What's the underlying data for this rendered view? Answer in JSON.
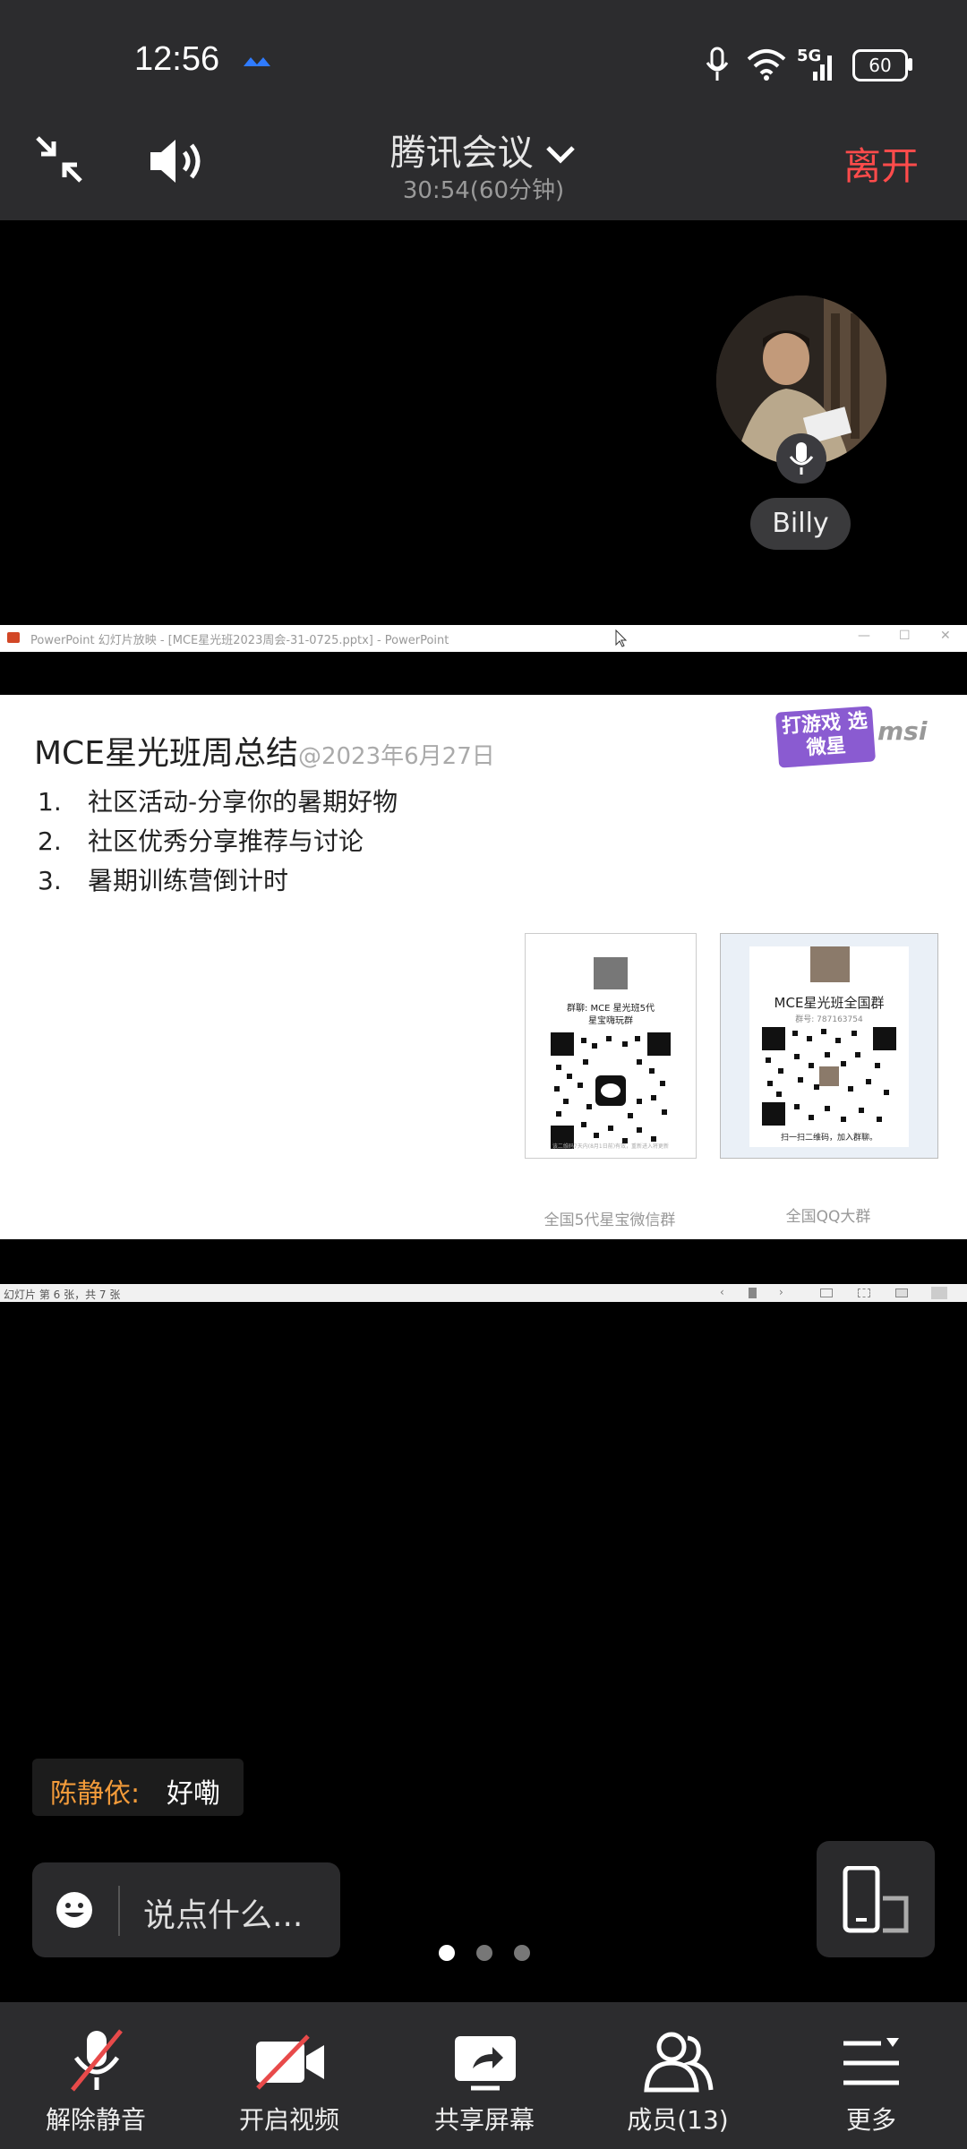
{
  "status_bar": {
    "time": "12:56",
    "network": "5G",
    "battery": "60"
  },
  "meeting": {
    "title": "腾讯会议",
    "duration": "30:54(60分钟)",
    "leave_label": "离开"
  },
  "participant": {
    "name": "Billy"
  },
  "ppt_window": {
    "title": "PowerPoint 幻灯片放映 - [MCE星光班2023周会-31-0725.pptx] - PowerPoint",
    "status_text": "幻灯片 第 6 张，共 7 张"
  },
  "slide": {
    "title": "MCE星光班周总结",
    "date": "@2023年6月27日",
    "items": [
      {
        "num": "1.",
        "text": "社区活动-分享你的暑期好物"
      },
      {
        "num": "2.",
        "text": "社区优秀分享推荐与讨论"
      },
      {
        "num": "3.",
        "text": "暑期训练营倒计时"
      }
    ],
    "logo_text": "打游戏 选微星",
    "brand": "msi",
    "qr_cards": [
      {
        "group_line1": "群聊: MCE 星光班5代",
        "group_line2": "星宝嗨玩群",
        "footer": "该二维码7天内(8月1日前)有效，重新进入将更新",
        "caption": "全国5代星宝微信群"
      },
      {
        "group_line1": "MCE星光班全国群",
        "group_line2": "群号: 787163754",
        "footer": "扫一扫二维码，加入群聊。",
        "caption": "全国QQ大群"
      }
    ]
  },
  "chat": {
    "sender": "陈静依:",
    "message": "好嘞",
    "input_placeholder": "说点什么..."
  },
  "pager": {
    "count": 3,
    "active": 1
  },
  "toolbar": {
    "unmute": "解除静音",
    "video": "开启视频",
    "share": "共享屏幕",
    "members": "成员(13)",
    "more": "更多"
  }
}
